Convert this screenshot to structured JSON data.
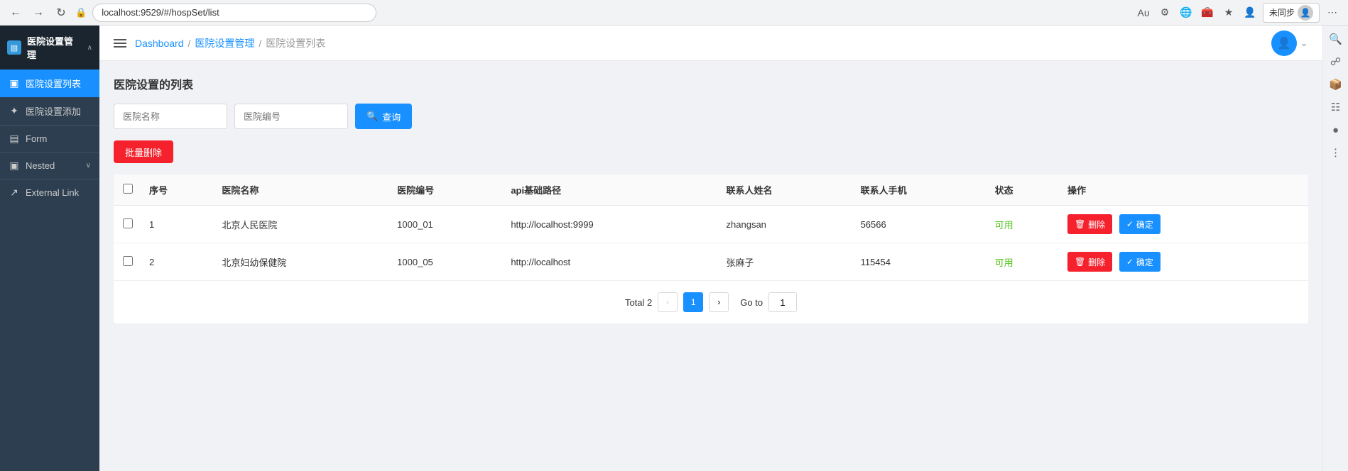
{
  "browser": {
    "url": "localhost:9529/#/hospSet/list",
    "nav_back": "←",
    "nav_forward": "→",
    "nav_refresh": "↻",
    "user_label": "未同步",
    "search_icon": "🔍"
  },
  "sidebar": {
    "header": {
      "title": "医院设置管理",
      "icon": "▤",
      "arrow": "∧"
    },
    "items": [
      {
        "id": "hospital-list",
        "label": "医院设置列表",
        "icon": "▣",
        "active": true
      },
      {
        "id": "hospital-add",
        "label": "医院设置添加",
        "icon": "✦",
        "active": false
      },
      {
        "id": "form",
        "label": "Form",
        "icon": "▤",
        "active": false
      },
      {
        "id": "nested",
        "label": "Nested",
        "icon": "▣",
        "active": false,
        "arrow": "∨"
      },
      {
        "id": "external-link",
        "label": "External Link",
        "icon": "↗",
        "active": false
      }
    ]
  },
  "topbar": {
    "menu_icon": "≡",
    "breadcrumb": [
      {
        "label": "Dashboard",
        "type": "link"
      },
      {
        "label": "医院设置管理",
        "type": "link"
      },
      {
        "label": "医院设置列表",
        "type": "current"
      }
    ]
  },
  "page": {
    "title": "医院设置的列表",
    "search": {
      "name_placeholder": "医院名称",
      "code_placeholder": "医院编号",
      "search_btn_label": "查询",
      "search_icon": "🔍"
    },
    "batch_delete_label": "批量删除",
    "table": {
      "columns": [
        "",
        "序号",
        "医院名称",
        "医院编号",
        "api基础路径",
        "联系人姓名",
        "联系人手机",
        "状态",
        "操作"
      ],
      "rows": [
        {
          "index": "1",
          "name": "北京人民医院",
          "code": "1000_01",
          "api": "http://localhost:9999",
          "contact": "zhangsan",
          "phone": "56566",
          "status": "可用"
        },
        {
          "index": "2",
          "name": "北京妇幼保健院",
          "code": "1000_05",
          "api": "http://localhost",
          "contact": "张麻子",
          "phone": "115454",
          "status": "可用"
        }
      ]
    },
    "pagination": {
      "total_label": "Total 2",
      "current_page": "1",
      "goto_label": "Go to",
      "goto_value": "1"
    },
    "actions": {
      "delete_label": "删除",
      "confirm_label": "确定",
      "delete_icon": "🗑",
      "confirm_icon": "✓"
    }
  }
}
